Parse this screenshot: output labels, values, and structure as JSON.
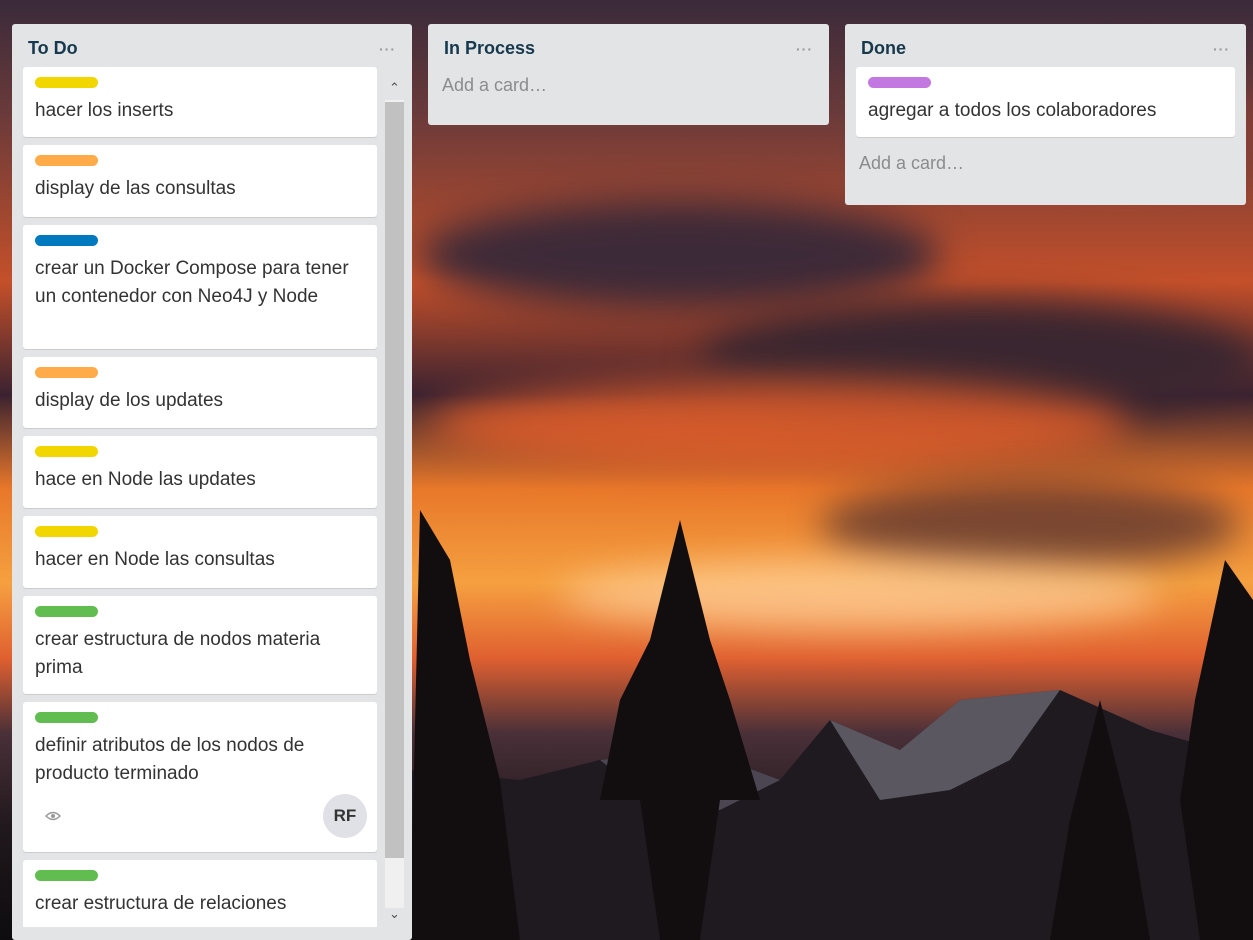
{
  "colors": {
    "yellow": "#f2d600",
    "orange": "#ffab4a",
    "blue": "#0079bf",
    "green": "#61bd4f",
    "purple": "#c377e0"
  },
  "lists": [
    {
      "title": "To Do",
      "menu": "···",
      "cards": [
        {
          "label_color": "#f2d600",
          "text": "hacer los inserts"
        },
        {
          "label_color": "#ffab4a",
          "text": "display de las consultas"
        },
        {
          "label_color": "#0079bf",
          "text": "crear un Docker Compose para tener un contenedor con Neo4J y Node"
        },
        {
          "label_color": "#ffab4a",
          "text": "display de los updates"
        },
        {
          "label_color": "#f2d600",
          "text": "hace en Node las updates"
        },
        {
          "label_color": "#f2d600",
          "text": "hacer en Node las consultas"
        },
        {
          "label_color": "#61bd4f",
          "text": "crear estructura de nodos materia prima"
        },
        {
          "label_color": "#61bd4f",
          "text": "definir atributos de los nodos de producto terminado",
          "avatar": "RF",
          "watch_icon": "eye-icon"
        },
        {
          "label_color": "#61bd4f",
          "text": "crear estructura de relaciones"
        }
      ]
    },
    {
      "title": "In Process",
      "menu": "···",
      "add_card": "Add a card…"
    },
    {
      "title": "Done",
      "menu": "···",
      "cards": [
        {
          "label_color": "#c377e0",
          "text": "agregar a todos los colaboradores"
        }
      ],
      "add_card": "Add a card…"
    }
  ]
}
